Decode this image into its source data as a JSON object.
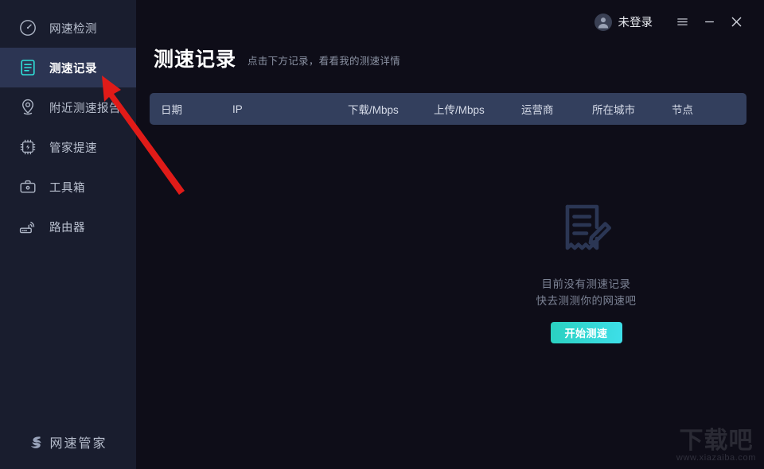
{
  "sidebar": {
    "items": [
      {
        "label": "网速检测",
        "icon": "speedometer-icon",
        "active": false
      },
      {
        "label": "测速记录",
        "icon": "document-list-icon",
        "active": true
      },
      {
        "label": "附近测速报告",
        "icon": "location-pin-icon",
        "active": false
      },
      {
        "label": "管家提速",
        "icon": "cpu-boost-icon",
        "active": false
      },
      {
        "label": "工具箱",
        "icon": "toolbox-icon",
        "active": false
      },
      {
        "label": "路由器",
        "icon": "router-wifi-icon",
        "active": false
      }
    ],
    "brand": "网速管家"
  },
  "titlebar": {
    "user_label": "未登录",
    "menu_icon": "hamburger-menu-icon",
    "minimize_icon": "minimize-icon",
    "close_icon": "close-icon"
  },
  "page": {
    "title": "测速记录",
    "subtitle": "点击下方记录，看看我的测速详情"
  },
  "table": {
    "columns": [
      "日期",
      "IP",
      "下载/Mbps",
      "上传/Mbps",
      "运营商",
      "所在城市",
      "节点"
    ],
    "rows": []
  },
  "empty_state": {
    "icon": "document-edit-icon",
    "line1": "目前没有测速记录",
    "line2": "快去测测你的网速吧",
    "button_label": "开始测速"
  },
  "watermark": {
    "title": "下载吧",
    "url": "www.xiazaiba.com"
  },
  "colors": {
    "sidebar_bg": "#191d2e",
    "main_bg": "#0e0d18",
    "active_item_bg": "#2c3553",
    "accent_cyan": "#2fe0d8",
    "table_header_bg": "#333f5d",
    "annotation_red": "#e01b18"
  }
}
